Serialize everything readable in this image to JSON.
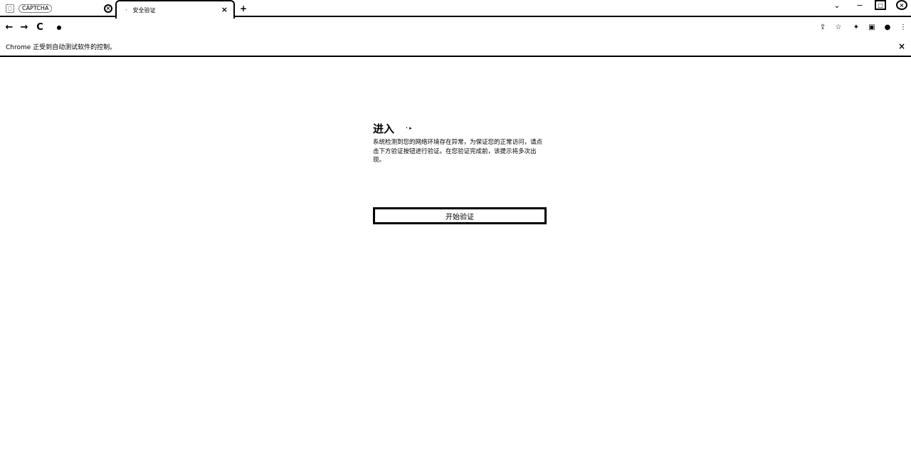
{
  "tabs": [
    {
      "label": "CAPTCHA",
      "favicon": "globe-icon"
    },
    {
      "label": "安全验证",
      "favicon": "loading-icon"
    }
  ],
  "toolbar": {
    "back": "←",
    "forward": "→",
    "reload": "C"
  },
  "infobar": {
    "message": "Chrome 正受到自动测试软件的控制。",
    "close": "×"
  },
  "main": {
    "heading": "进入",
    "description": "系统检测到您的网络环境存在异常，为保证您的正常访问，请点击下方验证按钮进行验证。在您验证完成前，该提示将多次出现。",
    "button_label": "开始验证"
  }
}
